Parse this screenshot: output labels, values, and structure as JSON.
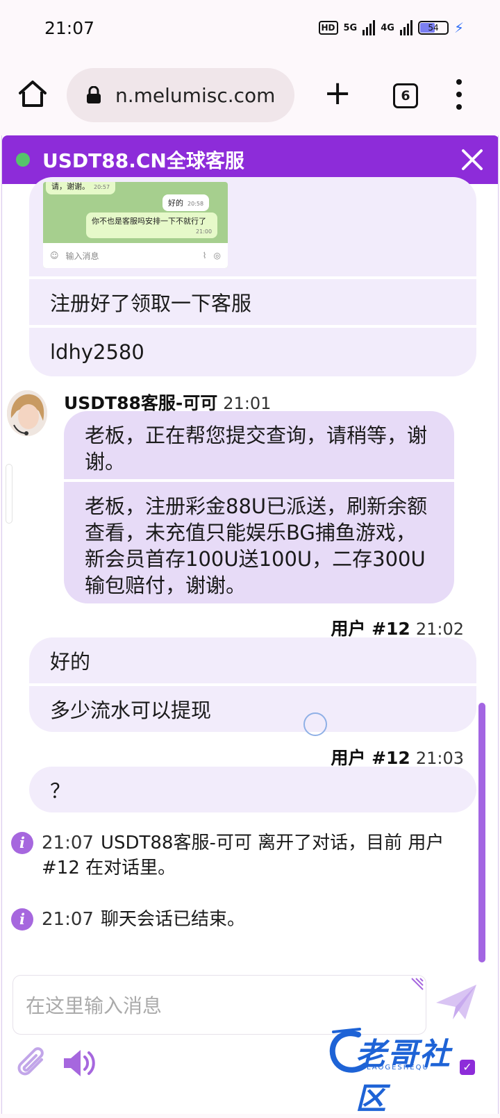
{
  "status_bar": {
    "time": "21:07",
    "hd": "HD",
    "net1": "5G",
    "net2": "4G",
    "battery": "54"
  },
  "browser": {
    "url": "n.melumisc.com",
    "tab_count": "6"
  },
  "chat": {
    "title": "USDT88.CN全球客服",
    "embed": {
      "msg_top": "请，谢谢。",
      "time_top": "20:57",
      "msg_ok": "好的",
      "time_ok": "20:58",
      "msg_ask": "你不也是客服吗安排一下不就行了",
      "time_ask": "21:00",
      "input_placeholder": "输入消息"
    },
    "user_group_1": [
      "注册好了领取一下客服",
      "ldhy2580"
    ],
    "agent": {
      "name": "USDT88客服-可可",
      "time": "21:01",
      "messages": [
        "老板，正在帮您提交查询，请稍等，谢谢。",
        "老板，注册彩金88U已派送，刷新余额查看，未充值只能娱乐BG捕鱼游戏，新会员首存100U送100U，二存300U输包赔付，谢谢。"
      ]
    },
    "user_block_2": {
      "name": "用户 #12",
      "time": "21:02",
      "messages": [
        "好的",
        "多少流水可以提现"
      ]
    },
    "user_block_3": {
      "name": "用户 #12",
      "time": "21:03",
      "messages": [
        "？"
      ]
    },
    "system": [
      {
        "time": "21:07",
        "text": "USDT88客服-可可 离开了对话，目前 用户 #12 在对话里。"
      },
      {
        "time": "21:07",
        "text": "聊天会话已结束。"
      }
    ],
    "input_placeholder": "在这里输入消息"
  },
  "watermark": {
    "title": "老哥社区",
    "subtitle": "LAOGESHEQU"
  },
  "colors": {
    "header": "#8d2cd9",
    "user_bubble": "#f2ecfb",
    "agent_bubble": "#e7dbf7",
    "online": "#56c46b",
    "info": "#a667de"
  }
}
